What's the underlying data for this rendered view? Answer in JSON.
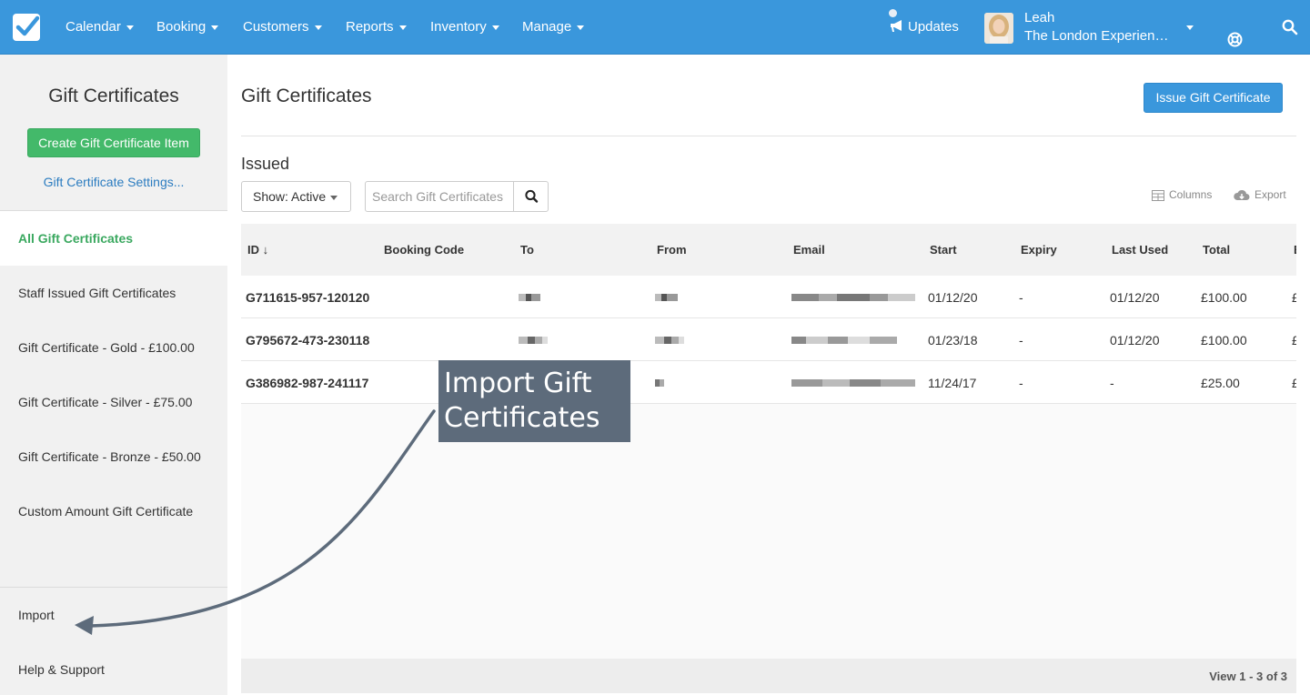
{
  "nav": {
    "items": [
      "Calendar",
      "Booking",
      "Customers",
      "Reports",
      "Inventory",
      "Manage"
    ],
    "updates_label": "Updates",
    "user_name": "Leah",
    "user_org": "The London Experience Co."
  },
  "sidebar": {
    "title": "Gift Certificates",
    "create_button": "Create Gift Certificate Item",
    "settings_link": "Gift Certificate Settings...",
    "items": [
      "All Gift Certificates",
      "Staff Issued Gift Certificates",
      "Gift Certificate - Gold - £100.00",
      "Gift Certificate - Silver - £75.00",
      "Gift Certificate - Bronze - £50.00",
      "Custom Amount Gift Certificate"
    ],
    "active_index": 0,
    "bottom_items": [
      "Import",
      "Help & Support"
    ]
  },
  "main": {
    "title": "Gift Certificates",
    "issue_button": "Issue Gift Certificate",
    "section_title": "Issued",
    "filter_label": "Show: Active",
    "search_placeholder": "Search Gift Certificates",
    "columns_label": "Columns",
    "export_label": "Export"
  },
  "table": {
    "columns": [
      "ID ↓",
      "Booking Code",
      "To",
      "From",
      "Email",
      "Start",
      "Expiry",
      "Last Used",
      "Total",
      "B"
    ],
    "rows": [
      {
        "id": "G711615-957-120120",
        "booking_code": "",
        "start": "01/12/20",
        "expiry": "-",
        "last_used": "01/12/20",
        "total": "£100.00",
        "balance": "£"
      },
      {
        "id": "G795672-473-230118",
        "booking_code": "",
        "start": "01/23/18",
        "expiry": "-",
        "last_used": "01/12/20",
        "total": "£100.00",
        "balance": "£"
      },
      {
        "id": "G386982-987-241117",
        "booking_code": "",
        "start": "11/24/17",
        "expiry": "-",
        "last_used": "-",
        "total": "£25.00",
        "balance": "£"
      }
    ],
    "footer": "View 1 - 3 of 3"
  },
  "annotation": {
    "text_line1": "Import Gift",
    "text_line2": "Certificates"
  },
  "colors": {
    "nav_blue": "#3a97dc",
    "green": "#43b96a",
    "callout": "#5d6b7b"
  }
}
